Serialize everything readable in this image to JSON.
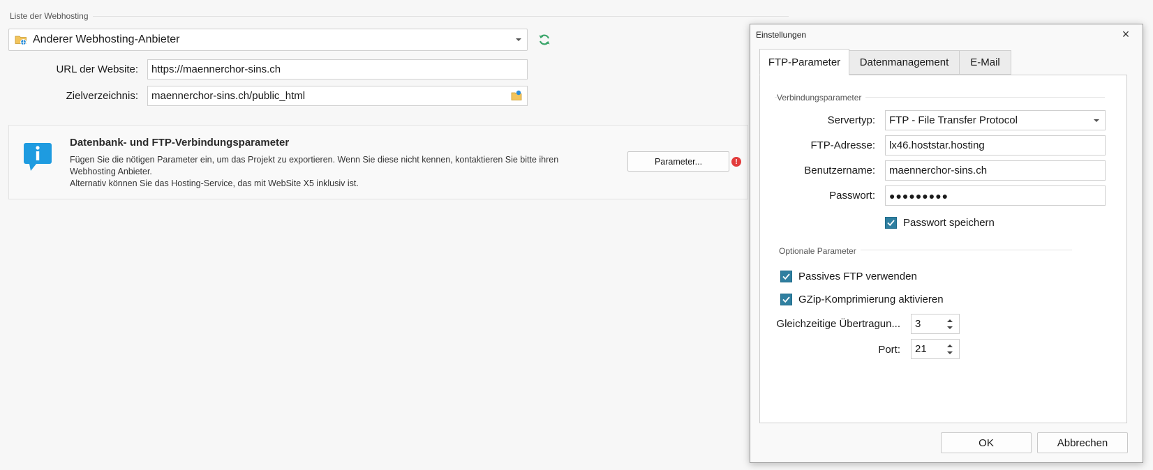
{
  "main": {
    "group_title": "Liste der Webhosting",
    "provider_select": {
      "value": "Anderer Webhosting-Anbieter"
    },
    "url": {
      "label": "URL der Website:",
      "value": "https://maennerchor-sins.ch"
    },
    "target_dir": {
      "label": "Zielverzeichnis:",
      "value": "maennerchor-sins.ch/public_html"
    },
    "info": {
      "title": "Datenbank- und FTP-Verbindungsparameter",
      "line1": "Fügen Sie die nötigen Parameter ein, um das Projekt zu exportieren. Wenn Sie diese nicht kennen, kontaktieren Sie bitte ihren",
      "line2": "Webhosting Anbieter.",
      "line3": "Alternativ können Sie das Hosting-Service, das mit WebSite X5 inklusiv ist.",
      "button": "Parameter...",
      "warning_symbol": "!"
    }
  },
  "dialog": {
    "title": "Einstellungen",
    "close_symbol": "×",
    "tabs": [
      "FTP-Parameter",
      "Datenmanagement",
      "E-Mail"
    ],
    "active_tab": "FTP-Parameter",
    "connection": {
      "section_title": "Verbindungsparameter",
      "server_type": {
        "label": "Servertyp:",
        "value": "FTP - File Transfer Protocol"
      },
      "ftp_address": {
        "label": "FTP-Adresse:",
        "value": "lx46.hoststar.hosting"
      },
      "username": {
        "label": "Benutzername:",
        "value": "maennerchor-sins.ch"
      },
      "password": {
        "label": "Passwort:",
        "value": "●●●●●●●●●"
      },
      "save_password": {
        "label": "Passwort speichern",
        "checked": true
      }
    },
    "optional": {
      "section_title": "Optionale Parameter",
      "passive_ftp": {
        "label": "Passives FTP verwenden",
        "checked": true
      },
      "gzip": {
        "label": "GZip-Komprimierung aktivieren",
        "checked": true
      },
      "simultaneous": {
        "label": "Gleichzeitige Übertragun...",
        "value": "3"
      },
      "port": {
        "label": "Port:",
        "value": "21"
      }
    },
    "buttons": {
      "ok": "OK",
      "cancel": "Abbrechen"
    }
  },
  "colors": {
    "accent": "#2f7fa0",
    "refresh": "#3aa56a",
    "info": "#1e9be0",
    "warning": "#e23c3c"
  },
  "icons": [
    "folder-web-icon",
    "refresh-icon",
    "folder-browse-icon",
    "info-icon",
    "warning-icon",
    "close-icon",
    "checkmark-icon",
    "chevron-down-icon"
  ]
}
